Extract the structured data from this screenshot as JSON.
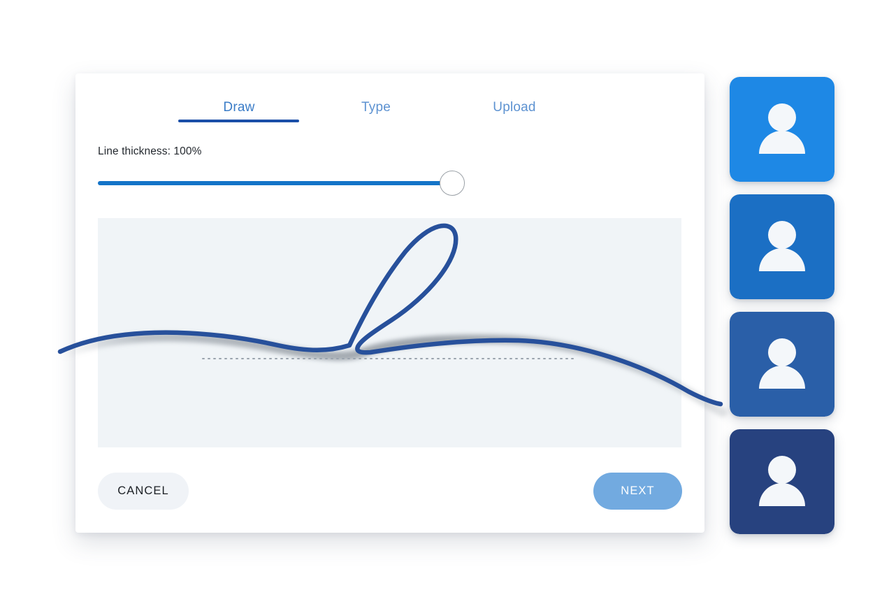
{
  "dialog": {
    "tabs": [
      {
        "id": "draw",
        "label": "Draw",
        "active": true
      },
      {
        "id": "type",
        "label": "Type",
        "active": false
      },
      {
        "id": "upload",
        "label": "Upload",
        "active": false
      }
    ],
    "thickness": {
      "label": "Line thickness: 100%",
      "value": 100,
      "min": 0,
      "max": 100
    },
    "canvas": {
      "name": "signature-drawing-area",
      "background_color": "#f0f4f7",
      "guideline": "dotted",
      "stroke_color": "#27509b",
      "content": "handwritten signature stroke"
    },
    "footer": {
      "cancel_label": "CANCEL",
      "next_label": "NEXT"
    }
  },
  "avatars": [
    {
      "name": "avatar-card-1",
      "color": "#1e88e5",
      "icon": "person-icon"
    },
    {
      "name": "avatar-card-2",
      "color": "#1b6fc4",
      "icon": "person-icon"
    },
    {
      "name": "avatar-card-3",
      "color": "#2a5fa8",
      "icon": "person-icon"
    },
    {
      "name": "avatar-card-4",
      "color": "#27427f",
      "icon": "person-icon"
    }
  ],
  "colors": {
    "tab_active": "#3a7cc7",
    "tab_inactive": "#5d92d1",
    "tab_underline": "#1b4fa8",
    "slider_track": "#1474c8",
    "next_button": "#72aae0",
    "cancel_button": "#f0f3f7",
    "signature_stroke": "#27509b"
  }
}
